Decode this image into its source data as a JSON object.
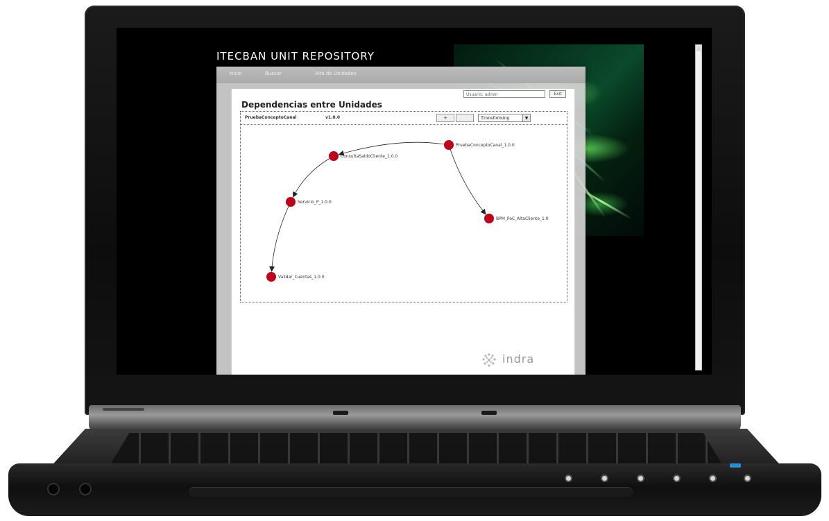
{
  "app": {
    "title": "ITECBAN UNIT REPOSITORY"
  },
  "nav": {
    "items": [
      "Inicio",
      "Buscar",
      "Alta de Unidades"
    ]
  },
  "user": {
    "label": "Usuario: admin",
    "logout_label": "Exit"
  },
  "page": {
    "heading": "Dependencias entre Unidades"
  },
  "graph_toolbar": {
    "unit_name": "PruebaConceptoCanal",
    "unit_version": "v1.0.0",
    "zoom_in_label": "+",
    "zoom_out_label": "",
    "mode_value": "Transforming"
  },
  "graph": {
    "node_color": "#c0001a",
    "nodes": [
      {
        "id": "n1",
        "label": "PruebaConceptoCanal_1.0.0"
      },
      {
        "id": "n2",
        "label": "ConsultaSaldoCliente_1.0.0"
      },
      {
        "id": "n3",
        "label": "BPM_PoC_AltaCliente_1.0"
      },
      {
        "id": "n4",
        "label": "Servicio_P_1.0.0"
      },
      {
        "id": "n5",
        "label": "Validar_Cuentas_1.0.0"
      }
    ],
    "edges": [
      {
        "from": "n1",
        "to": "n2"
      },
      {
        "from": "n1",
        "to": "n3"
      },
      {
        "from": "n2",
        "to": "n4"
      },
      {
        "from": "n4",
        "to": "n5"
      }
    ]
  },
  "brand": {
    "logo_text": "indra"
  }
}
